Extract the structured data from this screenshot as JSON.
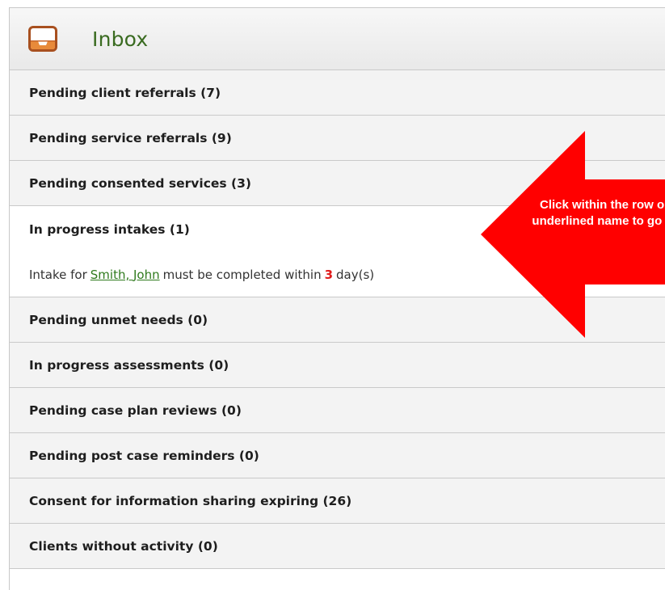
{
  "header": {
    "title": "Inbox",
    "icon": "inbox-tray-icon"
  },
  "rows": [
    {
      "label": "Pending client referrals (7)"
    },
    {
      "label": "Pending service referrals (9)"
    },
    {
      "label": "Pending consented services (3)"
    },
    {
      "label": "In progress intakes (1)"
    },
    {
      "label": "Pending unmet needs (0)"
    },
    {
      "label": "In progress assessments (0)"
    },
    {
      "label": "Pending case plan reviews (0)"
    },
    {
      "label": "Pending post case reminders (0)"
    },
    {
      "label": "Consent for information sharing expiring (26)"
    },
    {
      "label": "Clients without activity (0)"
    }
  ],
  "intake_detail": {
    "prefix": "Intake for",
    "client_name": "Smith, John",
    "middle": "must be completed within",
    "days": "3",
    "suffix": "day(s)"
  },
  "callout": {
    "line1": "Click within the row or",
    "line2": "underlined name to go to",
    "color": "#ff0000"
  },
  "colors": {
    "title": "#3a6b21",
    "link": "#2f7a1d",
    "days": "#e01b1b",
    "row_bg": "#f3f3f3"
  }
}
